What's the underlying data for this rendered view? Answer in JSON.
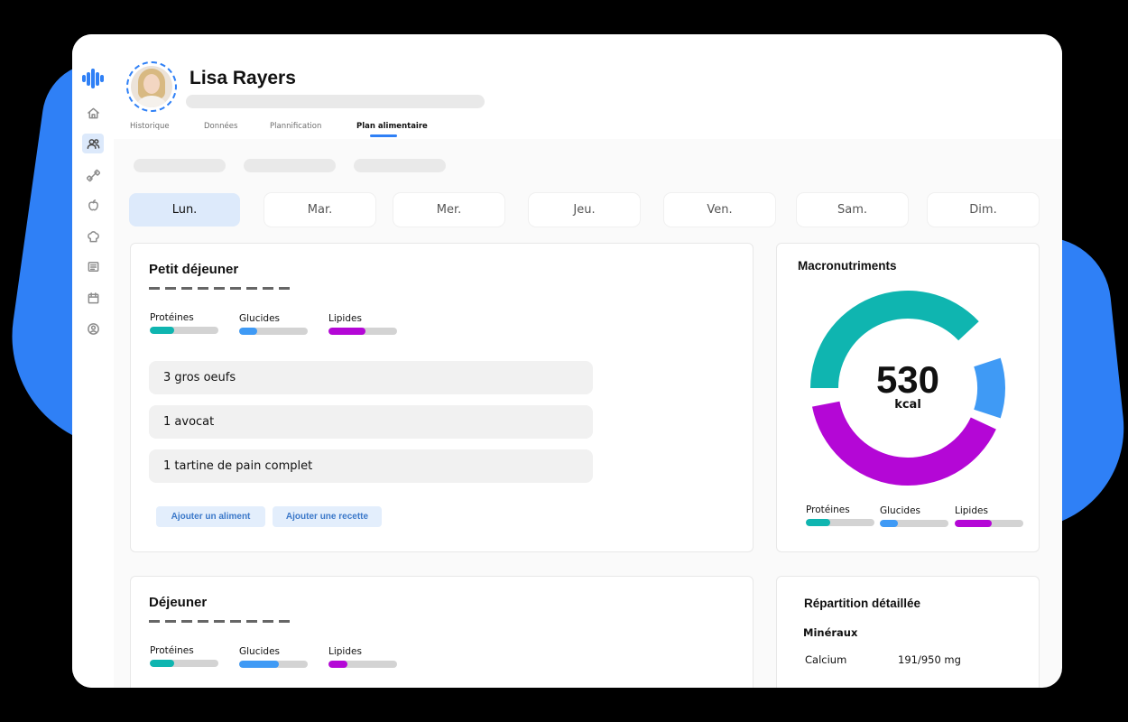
{
  "header": {
    "name": "Lisa Rayers",
    "tabs": [
      {
        "label": "Historique",
        "active": false
      },
      {
        "label": "Données",
        "active": false
      },
      {
        "label": "Plannification",
        "active": false
      },
      {
        "label": "Plan alimentaire",
        "active": true
      }
    ]
  },
  "sidebar": {
    "items": [
      {
        "icon": "home-icon",
        "active": false
      },
      {
        "icon": "users-icon",
        "active": true
      },
      {
        "icon": "dumbbell-icon",
        "active": false
      },
      {
        "icon": "apple-icon",
        "active": false
      },
      {
        "icon": "chef-hat-icon",
        "active": false
      },
      {
        "icon": "newspaper-icon",
        "active": false
      },
      {
        "icon": "calendar-icon",
        "active": false
      },
      {
        "icon": "user-circle-icon",
        "active": false
      }
    ]
  },
  "days": [
    {
      "label": "Lun.",
      "active": true
    },
    {
      "label": "Mar.",
      "active": false
    },
    {
      "label": "Mer.",
      "active": false
    },
    {
      "label": "Jeu.",
      "active": false
    },
    {
      "label": "Ven.",
      "active": false
    },
    {
      "label": "Sam.",
      "active": false
    },
    {
      "label": "Dim.",
      "active": false
    }
  ],
  "colors": {
    "proteines": "#0fb5b0",
    "glucides": "#3f9af5",
    "lipides": "#b407d6",
    "accent": "#2f80f6"
  },
  "breakfast": {
    "title": "Petit déjeuner",
    "macros": [
      {
        "label": "Protéines",
        "fraction": 0.36
      },
      {
        "label": "Glucides",
        "fraction": 0.26
      },
      {
        "label": "Lipides",
        "fraction": 0.54
      }
    ],
    "foods": [
      "3 gros oeufs",
      "1 avocat",
      "1 tartine de pain complet"
    ],
    "add_food_label": "Ajouter un aliment",
    "add_recipe_label": "Ajouter une recette"
  },
  "lunch": {
    "title": "Déjeuner",
    "macros": [
      {
        "label": "Protéines",
        "fraction": 0.36
      },
      {
        "label": "Glucides",
        "fraction": 0.58
      },
      {
        "label": "Lipides",
        "fraction": 0.28
      }
    ]
  },
  "macronutrients": {
    "title": "Macronutriments",
    "kcal_value": "530",
    "kcal_unit": "kcal",
    "segments": [
      {
        "name": "Protéines",
        "share": 0.38
      },
      {
        "name": "Glucides",
        "share": 0.1
      },
      {
        "name": "Lipides",
        "share": 0.4
      }
    ],
    "legend": [
      {
        "label": "Protéines",
        "fraction": 0.36
      },
      {
        "label": "Glucides",
        "fraction": 0.26
      },
      {
        "label": "Lipides",
        "fraction": 0.54
      }
    ]
  },
  "detail": {
    "title": "Répartition détaillée",
    "section": "Minéraux",
    "rows": [
      {
        "label": "Calcium",
        "value": "191/950 mg"
      }
    ]
  }
}
